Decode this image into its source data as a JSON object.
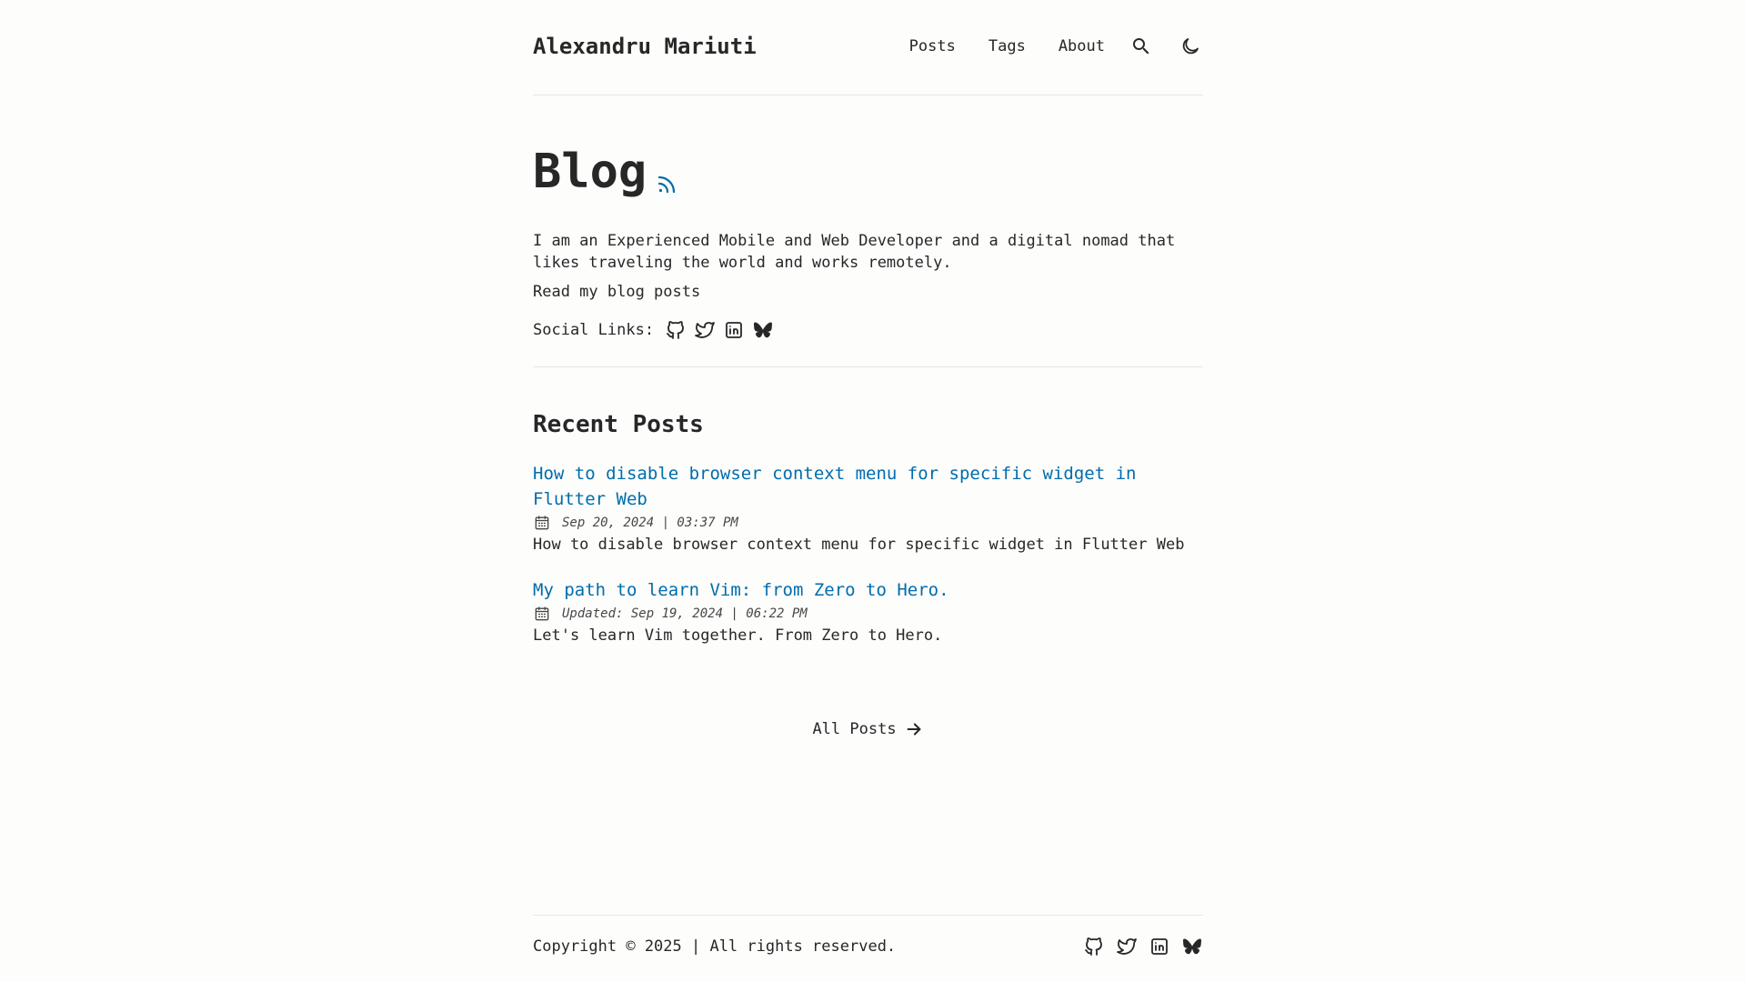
{
  "header": {
    "site_title": "Alexandru Mariuti",
    "nav": [
      {
        "label": "Posts"
      },
      {
        "label": "Tags"
      },
      {
        "label": "About"
      }
    ],
    "icons": [
      "search-icon",
      "moon-icon"
    ]
  },
  "hero": {
    "title": "Blog",
    "rss_icon": "rss-icon",
    "description": "I am an Experienced Mobile and Web Developer and a digital nomad that likes traveling the world and works remotely.",
    "read_text": "Read my blog posts",
    "social_label": "Social Links:",
    "social_icons": [
      "github-icon",
      "twitter-icon",
      "linkedin-icon",
      "bluesky-icon"
    ]
  },
  "recent": {
    "title": "Recent Posts",
    "posts": [
      {
        "title": "How to disable browser context menu for specific widget in Flutter Web",
        "date": "Sep 20, 2024 | 03:37 PM",
        "description": "How to disable browser context menu for specific widget in Flutter Web"
      },
      {
        "title": "My path to learn Vim: from Zero to Hero.",
        "date": "Updated: Sep 19, 2024 | 06:22 PM",
        "description": "Let's learn Vim together. From Zero to Hero."
      }
    ],
    "all_posts_label": "All Posts"
  },
  "footer": {
    "copyright": "Copyright © 2025 | All rights reserved.",
    "social_icons": [
      "github-icon",
      "twitter-icon",
      "linkedin-icon",
      "bluesky-icon"
    ]
  },
  "colors": {
    "background": "#fdfdfc",
    "text": "#282728",
    "accent": "#006cac",
    "border": "#e6e6e6"
  }
}
